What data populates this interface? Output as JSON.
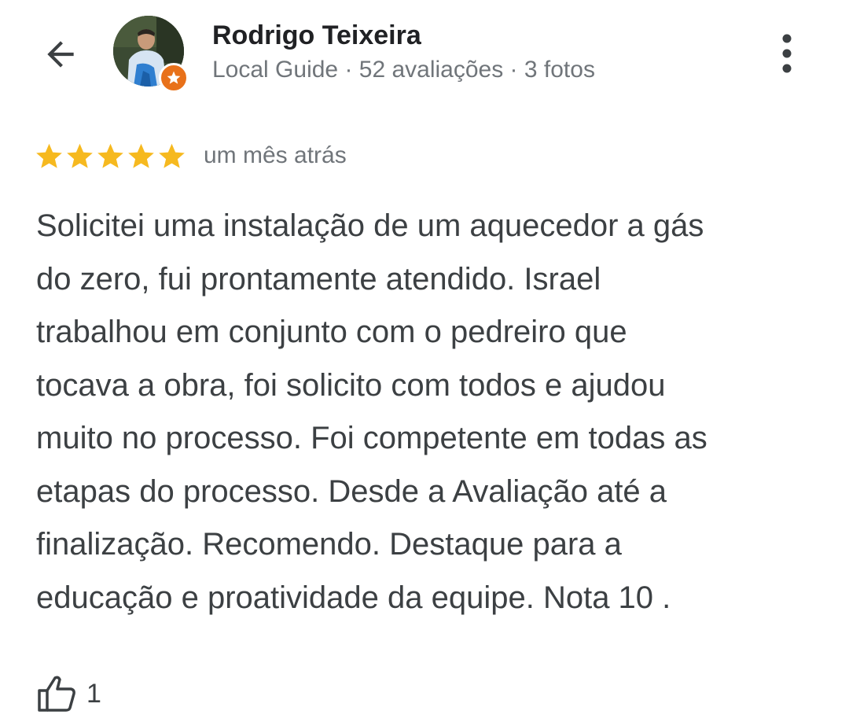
{
  "reviewer": {
    "name": "Rodrigo Teixeira",
    "meta": "Local Guide · 52 avaliações · 3 fotos"
  },
  "review": {
    "rating": 5,
    "date": "um mês atrás",
    "text_lines": [
      "Solicitei uma instalação de um aquecedor a gás",
      "do zero, fui prontamente atendido. Israel",
      "trabalhou em conjunto com o pedreiro que",
      "tocava a obra, foi solicito com todos e ajudou",
      "muito no processo. Foi competente em todas as",
      "etapas do processo. Desde a Avaliação até a",
      "finalização. Recomendo. Destaque para a",
      "educação e proatividade da equipe. Nota 10 ."
    ],
    "likes": "1"
  },
  "icons": {
    "back": "arrow-left-icon",
    "more": "more-vert-icon",
    "star": "star-icon",
    "like": "thumb-up-icon",
    "badge": "local-guide-star-icon"
  },
  "colors": {
    "star": "#f6b91f",
    "badge": "#e8711a",
    "name": "#202124",
    "meta": "#70757a",
    "body": "#3c4043"
  }
}
